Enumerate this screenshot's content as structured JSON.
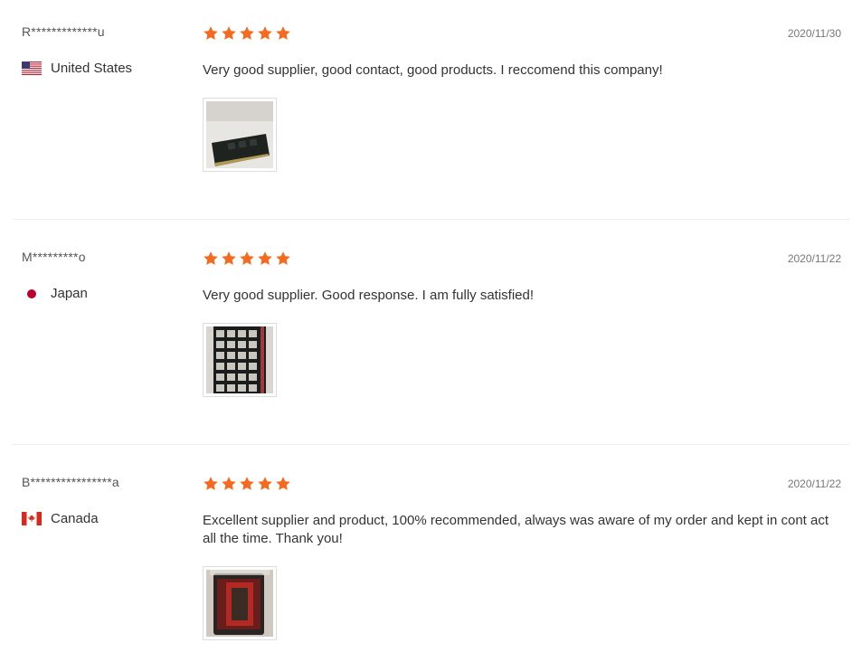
{
  "reviews": [
    {
      "reviewer": "R*************u",
      "country": "United States",
      "flag_icon": "us-flag-icon",
      "rating": 5,
      "date": "2020/11/30",
      "comment": "Very good supplier, good contact, good products. I reccomend this company!",
      "photo_icon": "ram-module-photo"
    },
    {
      "reviewer": "M*********o",
      "country": "Japan",
      "flag_icon": "japan-flag-icon",
      "rating": 5,
      "date": "2020/11/22",
      "comment": "Very good supplier. Good response. I am fully satisfied!",
      "photo_icon": "ram-tray-photo"
    },
    {
      "reviewer": "B****************a",
      "country": "Canada",
      "flag_icon": "canada-flag-icon",
      "rating": 5,
      "date": "2020/11/22",
      "comment": "Excellent supplier and product, 100% recommended, always was aware of my order and kept in cont act all the time. Thank you!",
      "photo_icon": "ram-package-photo"
    }
  ],
  "colors": {
    "star": "#f56a1f",
    "divider": "#eeeeee",
    "text": "#333333",
    "muted": "#777777"
  }
}
